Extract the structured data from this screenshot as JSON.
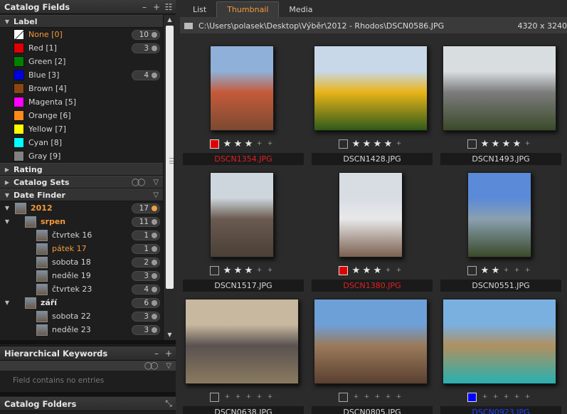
{
  "catalog_fields": {
    "title": "Catalog Fields",
    "label_section": "Label",
    "labels": [
      {
        "name": "None [0]",
        "color": "none",
        "count": "10",
        "highlight": true
      },
      {
        "name": "Red [1]",
        "color": "#e00000",
        "count": "3"
      },
      {
        "name": "Green [2]",
        "color": "#008000",
        "count": ""
      },
      {
        "name": "Blue [3]",
        "color": "#0000e0",
        "count": "4"
      },
      {
        "name": "Brown [4]",
        "color": "#8b4513",
        "count": ""
      },
      {
        "name": "Magenta [5]",
        "color": "#ff00ff",
        "count": ""
      },
      {
        "name": "Orange [6]",
        "color": "#ff8c1a",
        "count": ""
      },
      {
        "name": "Yellow [7]",
        "color": "#ffff00",
        "count": ""
      },
      {
        "name": "Cyan [8]",
        "color": "#00ffff",
        "count": ""
      },
      {
        "name": "Gray [9]",
        "color": "#808080",
        "count": ""
      }
    ],
    "rating_section": "Rating",
    "catalog_sets_section": "Catalog Sets",
    "date_finder_section": "Date Finder",
    "date_finder": {
      "year": {
        "label": "2012",
        "count": "17"
      },
      "months": [
        {
          "label": "srpen",
          "count": "11",
          "days": [
            {
              "label": "čtvrtek 16",
              "count": "1",
              "highlight": false
            },
            {
              "label": "pátek 17",
              "count": "1",
              "highlight": true
            },
            {
              "label": "sobota 18",
              "count": "2",
              "highlight": false
            },
            {
              "label": "neděle 19",
              "count": "3",
              "highlight": false
            },
            {
              "label": "čtvrtek 23",
              "count": "4",
              "highlight": false
            }
          ]
        },
        {
          "label": "září",
          "count": "6",
          "days": [
            {
              "label": "sobota 22",
              "count": "3",
              "highlight": false
            },
            {
              "label": "neděle 23",
              "count": "3",
              "highlight": false
            }
          ]
        }
      ]
    }
  },
  "hierarchical_keywords": {
    "title": "Hierarchical Keywords",
    "empty_text": "Field contains no entries"
  },
  "catalog_folders": {
    "title": "Catalog Folders"
  },
  "tabs": [
    "List",
    "Thumbnail",
    "Media"
  ],
  "active_tab": "Thumbnail",
  "path": "C:\\Users\\polasek\\Desktop\\Výběr\\2012 - Rhodos\\DSCN0586.JPG",
  "resolution": "4320 x 3240",
  "thumbnails": [
    {
      "file": "DSCN1354.JPG",
      "label_color": "#e00000",
      "stars": 3,
      "name_color": "red",
      "orientation": "portrait",
      "colors": [
        "#8fb0d8",
        "#c55a3a",
        "#7a4a32"
      ]
    },
    {
      "file": "DSCN1428.JPG",
      "label_color": "",
      "stars": 4,
      "name_color": "",
      "orientation": "landscape",
      "colors": [
        "#c8d8e8",
        "#e8b418",
        "#2e5a1a"
      ]
    },
    {
      "file": "DSCN1493.JPG",
      "label_color": "",
      "stars": 4,
      "name_color": "",
      "orientation": "landscape",
      "colors": [
        "#d8dde0",
        "#7c7c7c",
        "#3b4a2a"
      ]
    },
    {
      "file": "DSCN1517.JPG",
      "label_color": "",
      "stars": 3,
      "name_color": "",
      "orientation": "portrait",
      "colors": [
        "#cdd6dc",
        "#6a5a50",
        "#4a4036"
      ]
    },
    {
      "file": "DSCN1380.JPG",
      "label_color": "#e00000",
      "stars": 3,
      "name_color": "red",
      "orientation": "portrait",
      "colors": [
        "#d8dde4",
        "#e8e8e8",
        "#7a6050"
      ]
    },
    {
      "file": "DSCN0551.JPG",
      "label_color": "",
      "stars": 2,
      "name_color": "",
      "orientation": "portrait",
      "colors": [
        "#5a8ad8",
        "#8aa0b0",
        "#3a4a2a"
      ]
    },
    {
      "file": "DSCN0638.JPG",
      "label_color": "",
      "stars": 0,
      "name_color": "",
      "orientation": "landscape",
      "colors": [
        "#c8b8a0",
        "#5a5250",
        "#8a7a60"
      ]
    },
    {
      "file": "DSCN0805.JPG",
      "label_color": "",
      "stars": 0,
      "name_color": "",
      "orientation": "landscape",
      "colors": [
        "#6ea0d8",
        "#9a7a5a",
        "#5a4030"
      ]
    },
    {
      "file": "DSCN0923.JPG",
      "label_color": "#0000ff",
      "stars": 0,
      "name_color": "blue",
      "orientation": "landscape",
      "colors": [
        "#7ab0e0",
        "#b09060",
        "#28b0b0"
      ]
    }
  ]
}
